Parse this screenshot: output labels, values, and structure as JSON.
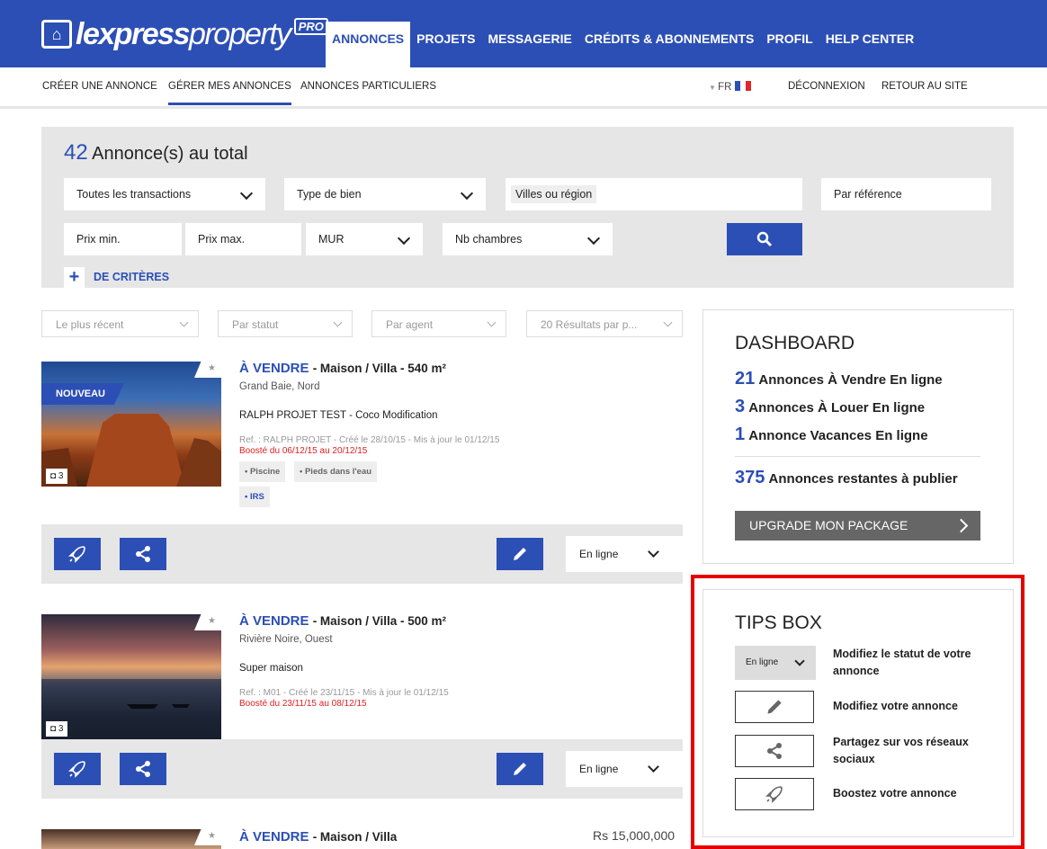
{
  "header": {
    "logo_main": "lexpress",
    "logo_second": "property",
    "logo_pro": "PRO",
    "nav": [
      "ANNONCES",
      "PROJETS",
      "MESSAGERIE",
      "CRÉDITS & ABONNEMENTS",
      "PROFIL",
      "HELP CENTER"
    ]
  },
  "subnav": {
    "create": "CRÉER UNE ANNONCE",
    "manage": "GÉRER MES ANNONCES",
    "private": "ANNONCES PARTICULIERS",
    "lang": "FR",
    "logout": "DÉCONNEXION",
    "back": "RETOUR AU SITE"
  },
  "search": {
    "total_count": "42",
    "total_label": "Annonce(s) au total",
    "transactions": "Toutes les transactions",
    "type": "Type de bien",
    "city": "Villes ou région",
    "reference": "Par référence",
    "price_min": "Prix min.",
    "price_max": "Prix max.",
    "currency": "MUR",
    "bedrooms": "Nb chambres",
    "more_plus": "+",
    "more_criteria": "DE CRITÈRES"
  },
  "filters": [
    "Le plus récent",
    "Par statut",
    "Par agent",
    "20 Résultats par p..."
  ],
  "listings": [
    {
      "badge": "NOUVEAU",
      "photos": "3",
      "status": "À VENDRE",
      "type": "- Maison / Villa - 540 m²",
      "location": "Grand Baie, Nord",
      "description": "RALPH PROJET TEST - Coco Modification",
      "ref": "Ref. : RALPH PROJET - Créé le 28/10/15 - Mis à jour le 01/12/15",
      "boost": "Boosté du 06/12/15 au 20/12/15",
      "tags": [
        "• Piscine",
        "• Pieds dans l'eau"
      ],
      "tag_blue": "• IRS",
      "online": "En ligne"
    },
    {
      "photos": "3",
      "status": "À VENDRE",
      "type": "- Maison / Villa - 500 m²",
      "location": "Rivière Noire, Ouest",
      "description": "Super maison",
      "ref": "Ref. : M01 - Créé le 23/11/15 - Mis à jour le 01/12/15",
      "boost": "Boosté du 23/11/15 au 08/12/15",
      "online": "En ligne"
    },
    {
      "status": "À VENDRE",
      "type": "- Maison / Villa",
      "price": "Rs 15,000,000"
    }
  ],
  "dashboard": {
    "title": "DASHBOARD",
    "l1n": "21",
    "l1": "Annonces À Vendre En ligne",
    "l2n": "3",
    "l2": "Annonces À Louer En ligne",
    "l3n": "1",
    "l3": "Annonce Vacances En ligne",
    "l4n": "375",
    "l4": "Annonces restantes à publier",
    "upgrade": "UPGRADE MON PACKAGE"
  },
  "tips": {
    "title": "TIPS BOX",
    "status_sample": "En ligne",
    "t1": "Modifiez le statut de votre annonce",
    "t2": "Modifiez votre annonce",
    "t3": "Partagez sur vos réseaux sociaux",
    "t4": "Boostez votre annonce"
  },
  "colors": {
    "brand": "#2c4fb5",
    "boost_red": "#e01e1e",
    "highlight": "#e60000"
  }
}
